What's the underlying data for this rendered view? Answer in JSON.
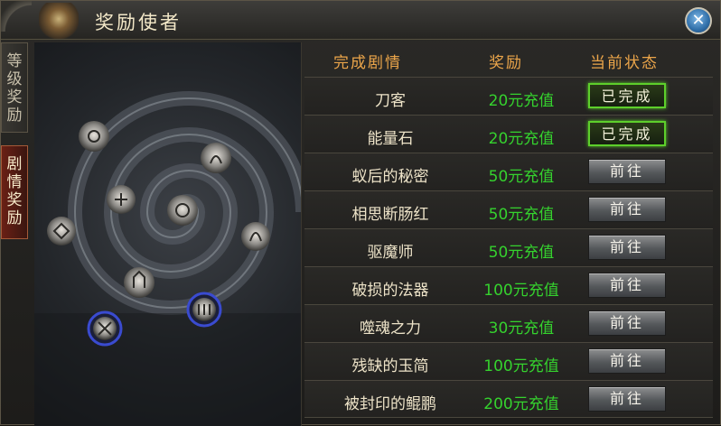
{
  "window": {
    "title": "奖励使者",
    "close_label": "✕"
  },
  "side_tabs": [
    {
      "chars": [
        "等",
        "级",
        "奖",
        "励"
      ],
      "active": false
    },
    {
      "chars": [
        "剧",
        "情",
        "奖",
        "励"
      ],
      "active": true
    }
  ],
  "table": {
    "headers": {
      "quest": "完成剧情",
      "reward": "奖励",
      "status": "当前状态"
    },
    "rows": [
      {
        "quest": "刀客",
        "reward": "20元充值",
        "status": "已完成",
        "done": true
      },
      {
        "quest": "能量石",
        "reward": "20元充值",
        "status": "已完成",
        "done": true
      },
      {
        "quest": "蚁后的秘密",
        "reward": "50元充值",
        "status": "前往",
        "done": false
      },
      {
        "quest": "相思断肠红",
        "reward": "50元充值",
        "status": "前往",
        "done": false
      },
      {
        "quest": "驱魔师",
        "reward": "50元充值",
        "status": "前往",
        "done": false
      },
      {
        "quest": "破损的法器",
        "reward": "100元充值",
        "status": "前往",
        "done": false
      },
      {
        "quest": "噬魂之力",
        "reward": "30元充值",
        "status": "前往",
        "done": false
      },
      {
        "quest": "残缺的玉简",
        "reward": "100元充值",
        "status": "前往",
        "done": false
      },
      {
        "quest": "被封印的鲲鹏",
        "reward": "200元充值",
        "status": "前往",
        "done": false
      }
    ]
  },
  "colors": {
    "header_text": "#eba54a",
    "reward_text": "#35d22e",
    "done_border": "#5dcf2b"
  }
}
